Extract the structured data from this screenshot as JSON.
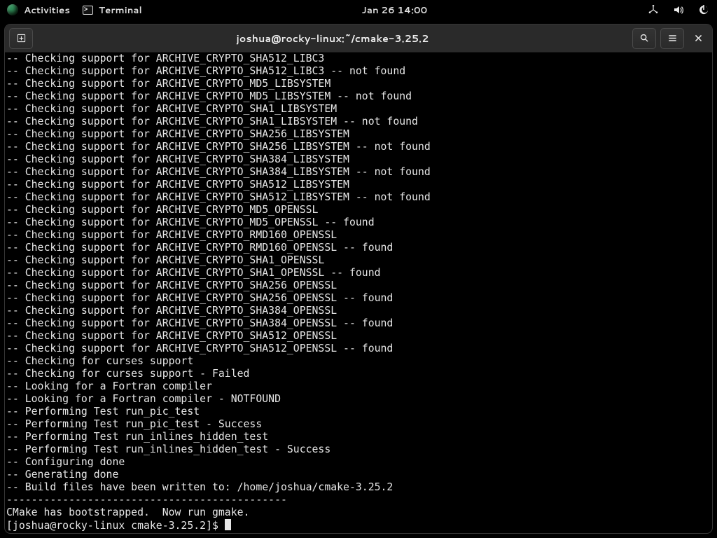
{
  "topbar": {
    "activities_label": "Activities",
    "app_label": "Terminal",
    "clock": "Jan 26  14:00"
  },
  "window": {
    "title": "joshua@rocky-linux:~/cmake-3.25.2"
  },
  "terminal": {
    "lines": [
      "-- Checking support for ARCHIVE_CRYPTO_SHA512_LIBC3",
      "-- Checking support for ARCHIVE_CRYPTO_SHA512_LIBC3 -- not found",
      "-- Checking support for ARCHIVE_CRYPTO_MD5_LIBSYSTEM",
      "-- Checking support for ARCHIVE_CRYPTO_MD5_LIBSYSTEM -- not found",
      "-- Checking support for ARCHIVE_CRYPTO_SHA1_LIBSYSTEM",
      "-- Checking support for ARCHIVE_CRYPTO_SHA1_LIBSYSTEM -- not found",
      "-- Checking support for ARCHIVE_CRYPTO_SHA256_LIBSYSTEM",
      "-- Checking support for ARCHIVE_CRYPTO_SHA256_LIBSYSTEM -- not found",
      "-- Checking support for ARCHIVE_CRYPTO_SHA384_LIBSYSTEM",
      "-- Checking support for ARCHIVE_CRYPTO_SHA384_LIBSYSTEM -- not found",
      "-- Checking support for ARCHIVE_CRYPTO_SHA512_LIBSYSTEM",
      "-- Checking support for ARCHIVE_CRYPTO_SHA512_LIBSYSTEM -- not found",
      "-- Checking support for ARCHIVE_CRYPTO_MD5_OPENSSL",
      "-- Checking support for ARCHIVE_CRYPTO_MD5_OPENSSL -- found",
      "-- Checking support for ARCHIVE_CRYPTO_RMD160_OPENSSL",
      "-- Checking support for ARCHIVE_CRYPTO_RMD160_OPENSSL -- found",
      "-- Checking support for ARCHIVE_CRYPTO_SHA1_OPENSSL",
      "-- Checking support for ARCHIVE_CRYPTO_SHA1_OPENSSL -- found",
      "-- Checking support for ARCHIVE_CRYPTO_SHA256_OPENSSL",
      "-- Checking support for ARCHIVE_CRYPTO_SHA256_OPENSSL -- found",
      "-- Checking support for ARCHIVE_CRYPTO_SHA384_OPENSSL",
      "-- Checking support for ARCHIVE_CRYPTO_SHA384_OPENSSL -- found",
      "-- Checking support for ARCHIVE_CRYPTO_SHA512_OPENSSL",
      "-- Checking support for ARCHIVE_CRYPTO_SHA512_OPENSSL -- found",
      "-- Checking for curses support",
      "-- Checking for curses support - Failed",
      "-- Looking for a Fortran compiler",
      "-- Looking for a Fortran compiler - NOTFOUND",
      "-- Performing Test run_pic_test",
      "-- Performing Test run_pic_test - Success",
      "-- Performing Test run_inlines_hidden_test",
      "-- Performing Test run_inlines_hidden_test - Success",
      "-- Configuring done",
      "-- Generating done",
      "-- Build files have been written to: /home/joshua/cmake-3.25.2",
      "---------------------------------------------",
      "CMake has bootstrapped.  Now run gmake."
    ],
    "prompt": "[joshua@rocky-linux cmake-3.25.2]$ "
  }
}
